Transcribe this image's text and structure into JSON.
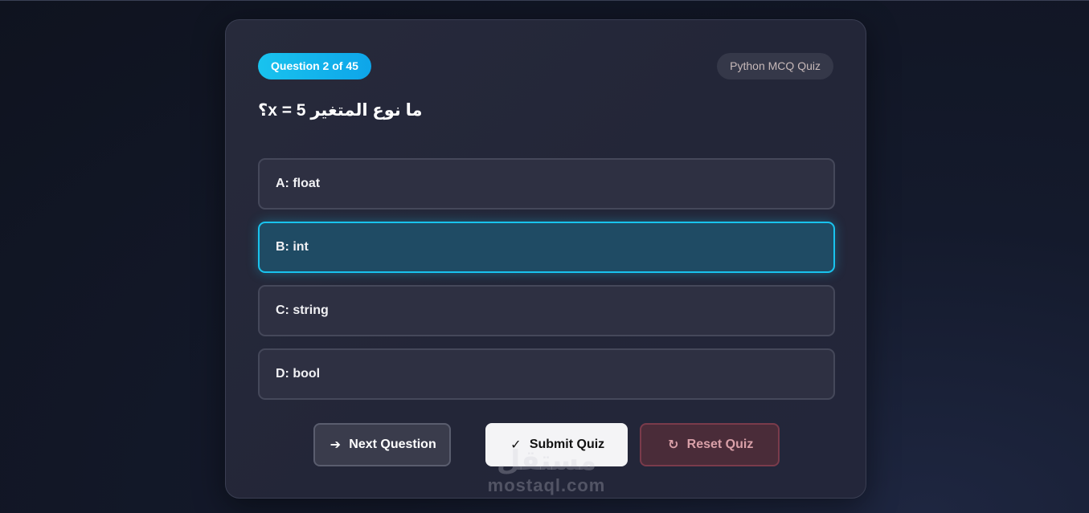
{
  "header": {
    "progress_label": "Question 2 of 45",
    "quiz_title": "Python MCQ Quiz"
  },
  "question": {
    "text": "ما نوع المتغير x = 5؟"
  },
  "options": [
    {
      "label": "A: float",
      "selected": false
    },
    {
      "label": "B: int",
      "selected": true
    },
    {
      "label": "C: string",
      "selected": false
    },
    {
      "label": "D: bool",
      "selected": false
    }
  ],
  "actions": {
    "next": {
      "label": "Next Question",
      "icon": "arrow-right-icon",
      "glyph": "➔"
    },
    "submit": {
      "label": "Submit Quiz",
      "icon": "check-icon",
      "glyph": "✓"
    },
    "reset": {
      "label": "Reset Quiz",
      "icon": "refresh-icon",
      "glyph": "↻"
    }
  },
  "watermark": {
    "arabic": "مستقل",
    "latin": "mostaql.com"
  },
  "colors": {
    "accent": "#19c3ee",
    "selected_bg": "#1f4b64",
    "reset_text": "#d9a0a8"
  }
}
